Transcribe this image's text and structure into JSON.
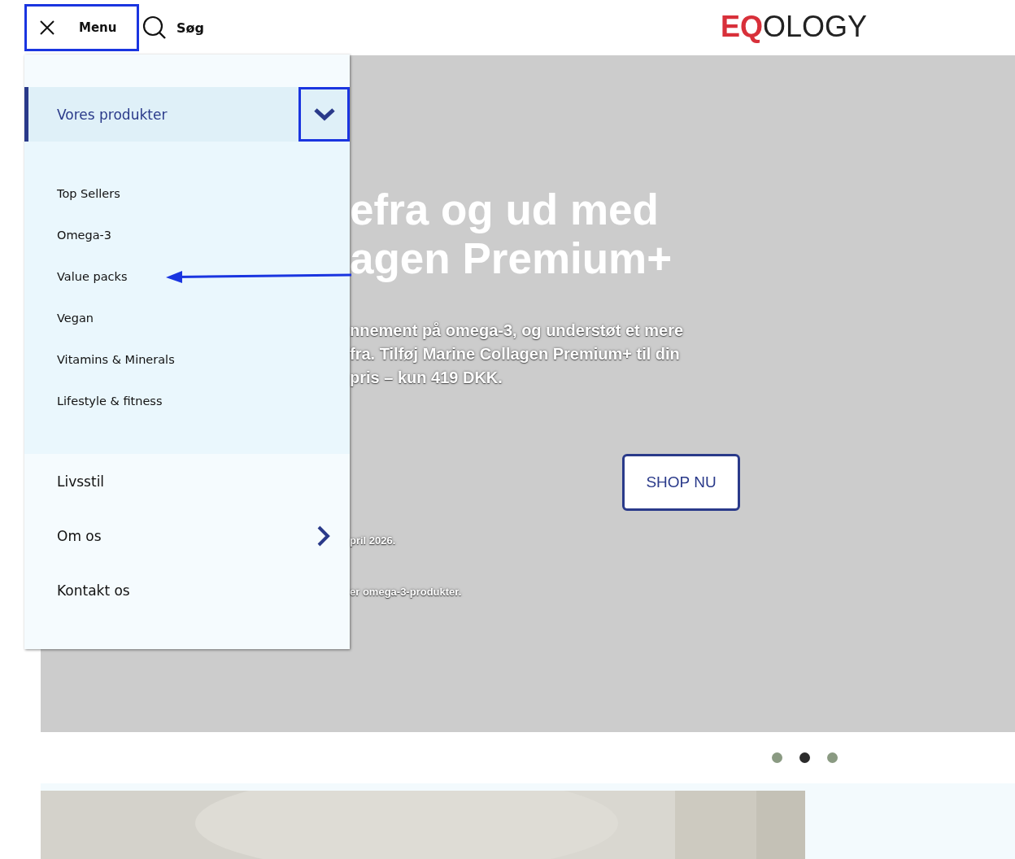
{
  "header": {
    "menu_button": {
      "label": "Menu",
      "highlighted": true
    },
    "search": {
      "label": "Søg"
    },
    "logo": "**EQ**OLOGY"
  },
  "menu": {
    "items": [
      {
        "kind": "expandable",
        "label": "Vores produkter",
        "expanded": true,
        "highlighted": true,
        "children": [
          {
            "label": "Top Sellers",
            "pointed": false
          },
          {
            "label": "Omega-3",
            "pointed": false
          },
          {
            "label": "Value packs",
            "pointed": true
          },
          {
            "label": "Vegan",
            "pointed": false
          },
          {
            "label": "Vitamins & Minerals",
            "pointed": false
          },
          {
            "label": "Lifestyle & fitness",
            "pointed": false
          }
        ]
      },
      {
        "kind": "link",
        "label": "Livsstil"
      },
      {
        "kind": "submenu",
        "label": "Om os"
      },
      {
        "kind": "link",
        "label": "Kontakt os"
      }
    ]
  },
  "hero": {
    "heading": [
      "efra og ud med",
      "agen Premium+"
    ],
    "body": [
      "nnement på omega-3, og understøt et mere",
      "fra. Tilføj Marine Collagen Premium+ til din",
      "pris – kun 419 DKK."
    ],
    "button": "SHOP NU",
    "notes": [
      "pril 2026.",
      "er omega-3-produkter."
    ]
  },
  "carousel": {
    "dots": [
      {
        "selected": false
      },
      {
        "selected": true
      },
      {
        "selected": false
      }
    ]
  }
}
